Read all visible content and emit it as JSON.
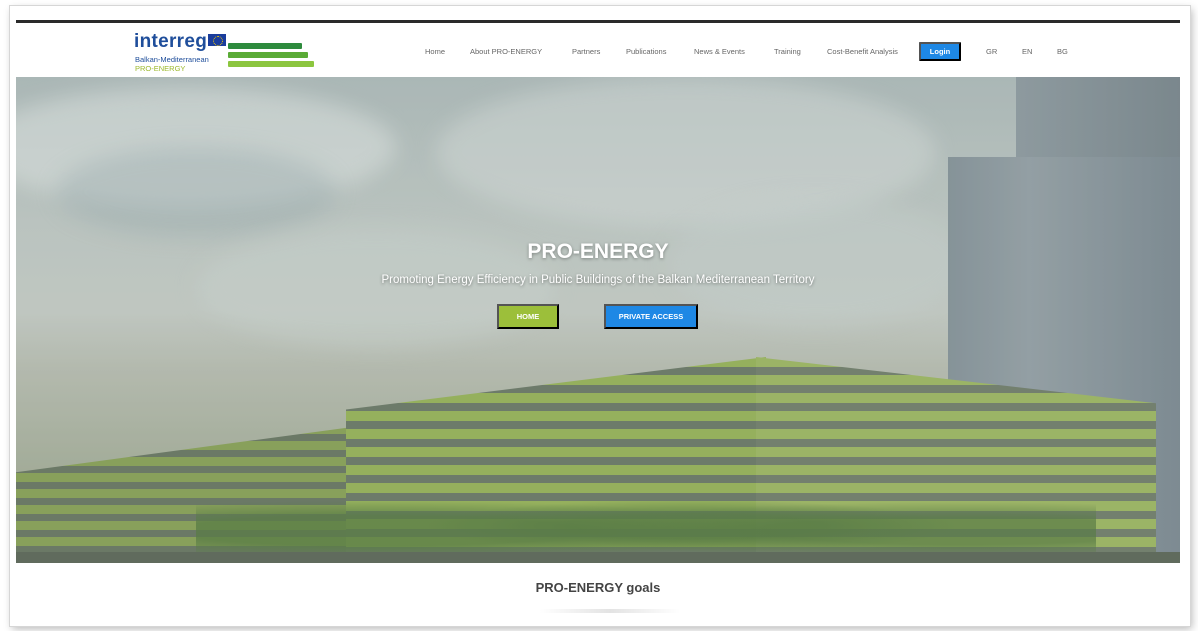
{
  "logo": {
    "word": "interreg",
    "line1": "Balkan-Mediterranean",
    "line2": "PRO-ENERGY"
  },
  "nav": {
    "items": [
      "Home",
      "About PRO-ENERGY",
      "Partners",
      "Publications",
      "News & Events",
      "Training",
      "Cost-Benefit Analysis"
    ],
    "login": "Login",
    "languages": [
      "GR",
      "EN",
      "BG"
    ]
  },
  "hero": {
    "title": "PRO-ENERGY",
    "subtitle": "Promoting Energy Efficiency in Public Buildings of the Balkan Mediterranean Territory",
    "home_button": "HOME",
    "private_button": "PRIVATE ACCESS"
  },
  "goals": {
    "title": "PRO-ENERGY goals"
  },
  "colors": {
    "accent_blue": "#1e88e5",
    "accent_green": "#9cbf3a",
    "brand_blue": "#1f4e9b"
  },
  "icons": [
    "eu-flag-icon"
  ]
}
